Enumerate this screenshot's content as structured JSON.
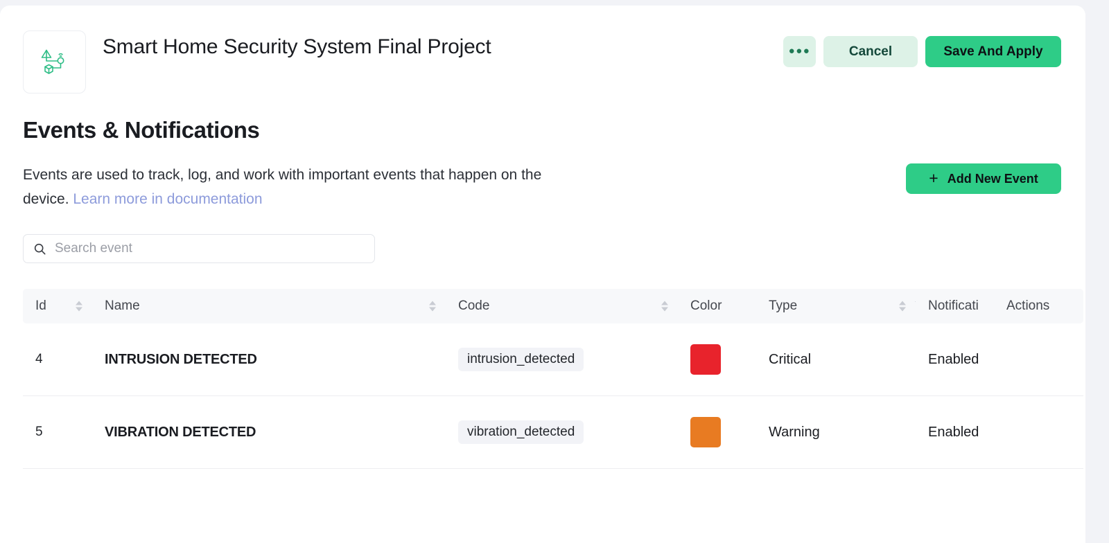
{
  "header": {
    "project_title": "Smart Home Security System Final Project",
    "logo_icon": "iot-device-diagram-icon",
    "more_button_label": "●●●",
    "more_button_icon": "ellipsis-icon",
    "cancel_label": "Cancel",
    "save_label": "Save And Apply"
  },
  "section": {
    "title": "Events & Notifications",
    "description_before": "Events are used to track, log, and work with important events that happen on the device. ",
    "description_link": "Learn more in documentation",
    "add_event_label": "Add New Event",
    "add_event_plus": "+"
  },
  "search": {
    "placeholder": "Search event",
    "value": "",
    "icon": "search-icon"
  },
  "table": {
    "columns": [
      {
        "key": "id",
        "label": "Id",
        "sortable": true,
        "filterable": false
      },
      {
        "key": "name",
        "label": "Name",
        "sortable": true,
        "filterable": false
      },
      {
        "key": "code",
        "label": "Code",
        "sortable": true,
        "filterable": false
      },
      {
        "key": "color",
        "label": "Color",
        "sortable": false,
        "filterable": false
      },
      {
        "key": "type",
        "label": "Type",
        "sortable": true,
        "filterable": true
      },
      {
        "key": "notif",
        "label": "Notificati",
        "sortable": false,
        "filterable": false
      },
      {
        "key": "actions",
        "label": "Actions",
        "sortable": false,
        "filterable": false
      }
    ],
    "rows": [
      {
        "id": "4",
        "name": "INTRUSION DETECTED",
        "code": "intrusion_detected",
        "color": "#e8232c",
        "type": "Critical",
        "notification": "Enabled",
        "actions": ""
      },
      {
        "id": "5",
        "name": "VIBRATION DETECTED",
        "code": "vibration_detected",
        "color": "#e87b22",
        "type": "Warning",
        "notification": "Enabled",
        "actions": ""
      }
    ]
  },
  "theme": {
    "accent_green": "#2ecc87",
    "accent_green_soft": "#ddf2e7",
    "link_blue": "#8d9bdb",
    "page_bg": "#f2f3f7",
    "table_header_bg": "#f7f8fa"
  }
}
